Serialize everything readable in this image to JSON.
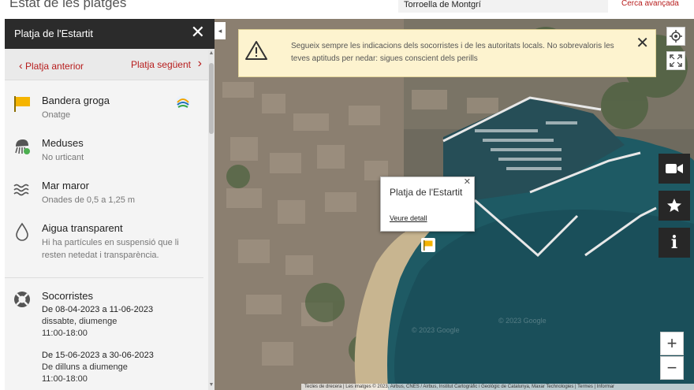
{
  "header": {
    "title": "Estat de les platges",
    "search_value": "Torroella de Montgrí",
    "advanced_search": "Cerca avançada"
  },
  "panel": {
    "title": "Platja de l'Estartit",
    "prev_label": "Platja anterior",
    "next_label": "Platja següent",
    "items": [
      {
        "icon": "yellow-flag-icon",
        "title": "Bandera groga",
        "sub": "Onatge"
      },
      {
        "icon": "jellyfish-icon",
        "title": "Meduses",
        "sub": "No urticant"
      },
      {
        "icon": "waves-icon",
        "title": "Mar maror",
        "sub": "Onades de 0,5 a 1,25 m"
      },
      {
        "icon": "water-drop-icon",
        "title": "Aigua transparent",
        "sub": "Hi ha partícules en suspensió que li resten netedat i transparència."
      }
    ],
    "lifeguards": {
      "title": "Socorristes",
      "periods": [
        {
          "dates": "De 08-04-2023 a 11-06-2023",
          "days": "dissabte, diumenge",
          "hours": "11:00-18:00"
        },
        {
          "dates": "De 15-06-2023 a 30-06-2023",
          "days": "De dilluns a diumenge",
          "hours": "11:00-18:00"
        }
      ]
    }
  },
  "map": {
    "alert_text": "Segueix sempre les indicacions dels socorristes i de les autoritats locals. No sobrevaloris les teves aptituds per nedar: sigues conscient dels perills",
    "popup_title": "Platja de l'Estartit",
    "popup_link": "Veure detall",
    "attribution": "Tecles de drecera | Les imatges © 2023, Airbus, CNES / Airbus, Institut Cartogràfic i Geològic de Catalunya, Maxar Technologies | Termes | Informar",
    "watermark": "© 2023 Google",
    "zoom_in": "+",
    "zoom_out": "−"
  },
  "colors": {
    "accent_red": "#b71c1c",
    "flag_yellow": "#f5b400",
    "panel_header": "#2b2b2b",
    "alert_bg": "#fdf3cf"
  }
}
